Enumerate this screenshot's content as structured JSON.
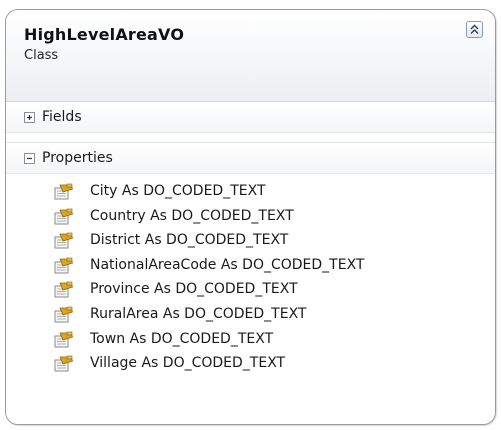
{
  "class": {
    "name": "HighLevelAreaVO",
    "kind": "Class"
  },
  "sections": {
    "fields_label": "Fields",
    "properties_label": "Properties"
  },
  "properties": [
    "City As DO_CODED_TEXT",
    "Country As DO_CODED_TEXT",
    "District As DO_CODED_TEXT",
    "NationalAreaCode As DO_CODED_TEXT",
    "Province As DO_CODED_TEXT",
    "RuralArea As DO_CODED_TEXT",
    "Town As DO_CODED_TEXT",
    "Village As DO_CODED_TEXT"
  ],
  "icons": {
    "collapse": "double-chevron-up-icon",
    "expand": "plus-icon",
    "collapse_section": "minus-icon",
    "property": "property-icon"
  }
}
